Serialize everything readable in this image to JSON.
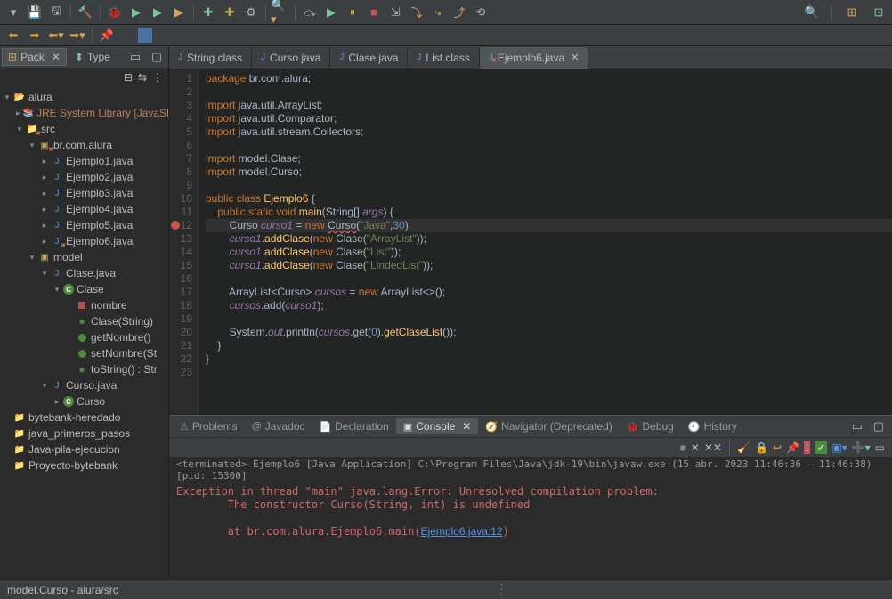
{
  "toolbar": {
    "icons": [
      "new",
      "save",
      "saveall",
      "print",
      "build",
      "debug",
      "extdbg",
      "cov",
      "run-dd",
      "run",
      "stop",
      "hot",
      "runb",
      "skip",
      "a",
      "b",
      "c",
      "suspend",
      "resumed",
      "bug",
      "play",
      "pause",
      "stepover",
      "stepinto",
      "stepout",
      "stepret",
      "search",
      "arrows"
    ],
    "right": {
      "search": "🔍",
      "persp1": "⊞",
      "persp2": "⊡"
    }
  },
  "sidebar": {
    "tabs": {
      "pack": "Pack",
      "type": "Type"
    },
    "tree": [
      {
        "d": 0,
        "tw": "▾",
        "ic": "proj-err",
        "label": "alura"
      },
      {
        "d": 1,
        "tw": "▸",
        "ic": "jre",
        "label": "JRE System Library [JavaSE",
        "cls": "err-lib"
      },
      {
        "d": 1,
        "tw": "▾",
        "ic": "src-err",
        "label": "src"
      },
      {
        "d": 2,
        "tw": "▾",
        "ic": "pkg-err",
        "label": "br.com.alura"
      },
      {
        "d": 3,
        "tw": "▸",
        "ic": "jfile",
        "label": "Ejemplo1.java"
      },
      {
        "d": 3,
        "tw": "▸",
        "ic": "jfile",
        "label": "Ejemplo2.java"
      },
      {
        "d": 3,
        "tw": "▸",
        "ic": "jfile",
        "label": "Ejemplo3.java"
      },
      {
        "d": 3,
        "tw": "▸",
        "ic": "jfile",
        "label": "Ejemplo4.java"
      },
      {
        "d": 3,
        "tw": "▸",
        "ic": "jfile",
        "label": "Ejemplo5.java"
      },
      {
        "d": 3,
        "tw": "▸",
        "ic": "jfile-err",
        "label": "Ejemplo6.java"
      },
      {
        "d": 2,
        "tw": "▾",
        "ic": "pkg",
        "label": "model"
      },
      {
        "d": 3,
        "tw": "▾",
        "ic": "jfile",
        "label": "Clase.java"
      },
      {
        "d": 4,
        "tw": "▾",
        "ic": "class",
        "label": "Clase"
      },
      {
        "d": 5,
        "tw": "",
        "ic": "field-red",
        "label": "nombre"
      },
      {
        "d": 5,
        "tw": "",
        "ic": "meth-pub",
        "label": "Clase(String)"
      },
      {
        "d": 5,
        "tw": "",
        "ic": "meth-green",
        "label": "getNombre()"
      },
      {
        "d": 5,
        "tw": "",
        "ic": "meth-green",
        "label": "setNombre(St"
      },
      {
        "d": 5,
        "tw": "",
        "ic": "meth-pub",
        "label": "toString() : Str"
      },
      {
        "d": 3,
        "tw": "▾",
        "ic": "jfile",
        "label": "Curso.java"
      },
      {
        "d": 4,
        "tw": "▸",
        "ic": "class",
        "label": "Curso"
      },
      {
        "d": 0,
        "tw": "",
        "ic": "folder",
        "label": "bytebank-heredado"
      },
      {
        "d": 0,
        "tw": "",
        "ic": "folder",
        "label": "java_primeros_pasos"
      },
      {
        "d": 0,
        "tw": "",
        "ic": "folder",
        "label": "Java-pila-ejecucion"
      },
      {
        "d": 0,
        "tw": "",
        "ic": "folder",
        "label": "Proyecto-bytebank"
      }
    ]
  },
  "editor": {
    "tabs": [
      {
        "label": "String.class",
        "ic": "j",
        "active": false,
        "close": false
      },
      {
        "label": "Curso.java",
        "ic": "j",
        "active": false,
        "close": false
      },
      {
        "label": "Clase.java",
        "ic": "j",
        "active": false,
        "close": false
      },
      {
        "label": "List.class",
        "ic": "j",
        "active": false,
        "close": false
      },
      {
        "label": "Ejemplo6.java",
        "ic": "jerr",
        "active": true,
        "close": true
      }
    ],
    "lines": 23,
    "breakpoint_line": 12,
    "highlight_line": 12,
    "code": {
      "1": [
        [
          "kw",
          "package"
        ],
        [
          "nm",
          " br.com.alura;"
        ]
      ],
      "2": [],
      "3": [
        [
          "kw",
          "import"
        ],
        [
          "nm",
          " java.util.ArrayList;"
        ]
      ],
      "4": [
        [
          "kw",
          "import"
        ],
        [
          "nm",
          " java.util.Comparator;"
        ]
      ],
      "5": [
        [
          "kw",
          "import"
        ],
        [
          "nm",
          " java.util.stream.Collectors;"
        ]
      ],
      "6": [],
      "7": [
        [
          "kw",
          "import"
        ],
        [
          "nm",
          " model.Clase;"
        ]
      ],
      "8": [
        [
          "kw",
          "import"
        ],
        [
          "nm",
          " model.Curso;"
        ]
      ],
      "9": [],
      "10": [
        [
          "kw",
          "public class "
        ],
        [
          "cls",
          "Ejemplo6"
        ],
        [
          "nm",
          " {"
        ]
      ],
      "11": [
        [
          "nm",
          "    "
        ],
        [
          "kw",
          "public static void "
        ],
        [
          "meth",
          "main"
        ],
        [
          "nm",
          "("
        ],
        [
          "type",
          "String"
        ],
        [
          "nm",
          "[] "
        ],
        [
          "var",
          "args"
        ],
        [
          "nm",
          ") {"
        ]
      ],
      "12": [
        [
          "nm",
          "        "
        ],
        [
          "type",
          "Curso"
        ],
        [
          "nm",
          " "
        ],
        [
          "var",
          "curso1"
        ],
        [
          "nm",
          " = "
        ],
        [
          "kw",
          "new "
        ],
        [
          "errund",
          "Curso"
        ],
        [
          "nm",
          "("
        ],
        [
          "str",
          "\"Java\""
        ],
        [
          "nm",
          ","
        ],
        [
          "num",
          "30"
        ],
        [
          "nm",
          ");"
        ]
      ],
      "13": [
        [
          "nm",
          "        "
        ],
        [
          "var",
          "curso1"
        ],
        [
          "nm",
          "."
        ],
        [
          "meth",
          "addClase"
        ],
        [
          "nm",
          "("
        ],
        [
          "kw",
          "new "
        ],
        [
          "type",
          "Clase"
        ],
        [
          "nm",
          "("
        ],
        [
          "str",
          "\"ArrayList\""
        ],
        [
          "nm",
          "));"
        ]
      ],
      "14": [
        [
          "nm",
          "        "
        ],
        [
          "var",
          "curso1"
        ],
        [
          "nm",
          "."
        ],
        [
          "meth",
          "addClase"
        ],
        [
          "nm",
          "("
        ],
        [
          "kw",
          "new "
        ],
        [
          "type",
          "Clase"
        ],
        [
          "nm",
          "("
        ],
        [
          "str",
          "\"List\""
        ],
        [
          "nm",
          "));"
        ]
      ],
      "15": [
        [
          "nm",
          "        "
        ],
        [
          "var",
          "curso1"
        ],
        [
          "nm",
          "."
        ],
        [
          "meth",
          "addClase"
        ],
        [
          "nm",
          "("
        ],
        [
          "kw",
          "new "
        ],
        [
          "type",
          "Clase"
        ],
        [
          "nm",
          "("
        ],
        [
          "str",
          "\"LindedList\""
        ],
        [
          "nm",
          "));"
        ]
      ],
      "16": [],
      "17": [
        [
          "nm",
          "        "
        ],
        [
          "type",
          "ArrayList"
        ],
        [
          "nm",
          "<"
        ],
        [
          "type",
          "Curso"
        ],
        [
          "nm",
          "> "
        ],
        [
          "var",
          "cursos"
        ],
        [
          "nm",
          " = "
        ],
        [
          "kw",
          "new "
        ],
        [
          "type",
          "ArrayList"
        ],
        [
          "nm",
          "<>();"
        ]
      ],
      "18": [
        [
          "nm",
          "        "
        ],
        [
          "var",
          "cursos"
        ],
        [
          "nm",
          ".add("
        ],
        [
          "var",
          "curso1"
        ],
        [
          "nm",
          ");"
        ]
      ],
      "19": [],
      "20": [
        [
          "nm",
          "        "
        ],
        [
          "type",
          "System"
        ],
        [
          "nm",
          "."
        ],
        [
          "var",
          "out"
        ],
        [
          "nm",
          ".println("
        ],
        [
          "var",
          "cursos"
        ],
        [
          "nm",
          ".get("
        ],
        [
          "num",
          "0"
        ],
        [
          "nm",
          ")."
        ],
        [
          "meth",
          "getClaseList"
        ],
        [
          "nm",
          "());"
        ]
      ],
      "21": [
        [
          "nm",
          "    }"
        ]
      ],
      "22": [
        [
          "nm",
          "}"
        ]
      ],
      "23": []
    }
  },
  "bottom": {
    "tabs": [
      {
        "label": "Problems",
        "ic": "⚠",
        "active": false
      },
      {
        "label": "Javadoc",
        "ic": "@",
        "active": false
      },
      {
        "label": "Declaration",
        "ic": "📄",
        "active": false
      },
      {
        "label": "Console",
        "ic": "▣",
        "active": true,
        "close": true
      },
      {
        "label": "Navigator (Deprecated)",
        "ic": "🧭",
        "active": false
      },
      {
        "label": "Debug",
        "ic": "🐞",
        "active": false
      },
      {
        "label": "History",
        "ic": "🕘",
        "active": false
      }
    ],
    "console_header": "<terminated> Ejemplo6 [Java Application] C:\\Program Files\\Java\\jdk-19\\bin\\javaw.exe  (15 abr. 2023 11:46:36 – 11:46:38) [pid: 15300]",
    "console_lines": [
      "Exception in thread \"main\" java.lang.Error: Unresolved compilation problem: ",
      "        The constructor Curso(String, int) is undefined",
      "",
      "        at br.com.alura.Ejemplo6.main("
    ],
    "console_link": "Ejemplo6.java:12",
    "console_tail": ")"
  },
  "status": {
    "text": "model.Curso - alura/src"
  }
}
